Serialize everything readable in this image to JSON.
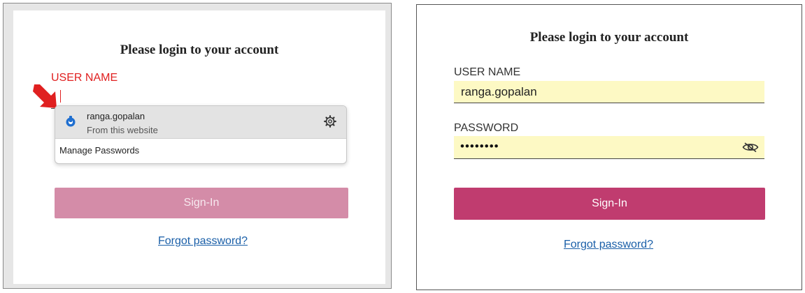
{
  "left": {
    "title": "Please login to your account",
    "username_label": "USER NAME",
    "autofill": {
      "username": "ranga.gopalan",
      "subtitle": "From this website",
      "manage_label": "Manage Passwords"
    },
    "signin_label": "Sign-In",
    "forgot_label": "Forgot password?"
  },
  "right": {
    "title": "Please login to your account",
    "username_label": "USER NAME",
    "username_value": "ranga.gopalan",
    "password_label": "PASSWORD",
    "password_masked": "••••••••",
    "signin_label": "Sign-In",
    "forgot_label": "Forgot password?"
  },
  "icons": [
    "arrow-pointer-icon",
    "site-favicon-icon",
    "gear-icon",
    "eye-slash-icon"
  ],
  "colors": {
    "label_active": "#e02020",
    "button_disabled": "#d48ca8",
    "button_primary": "#c03c6f",
    "field_fill": "#fdf9c4",
    "link": "#1a5fa8"
  }
}
